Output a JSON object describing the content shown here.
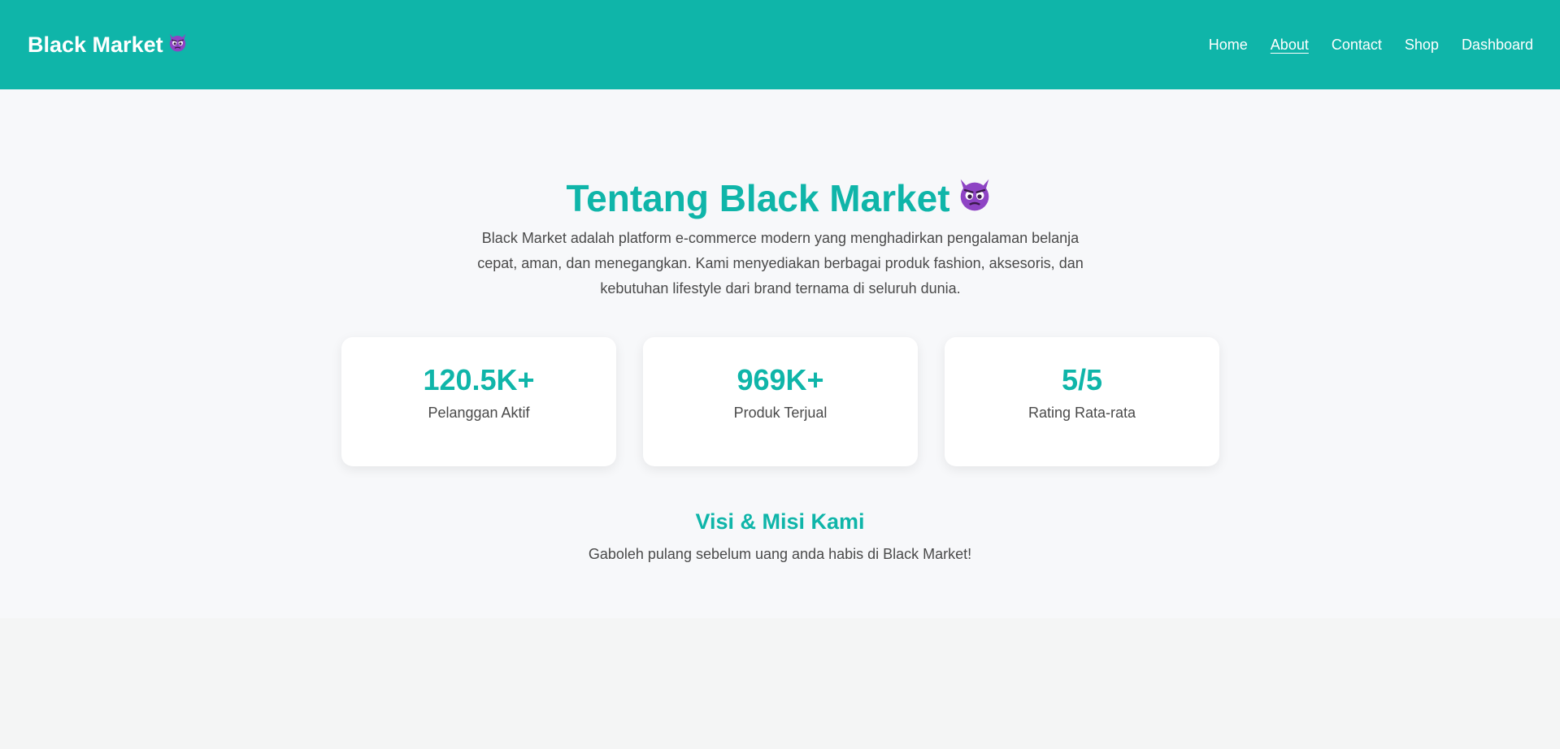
{
  "navbar": {
    "brand": "Black Market",
    "brand_icon": "devil-emoji",
    "links": [
      {
        "label": "Home",
        "active": false
      },
      {
        "label": "About",
        "active": true
      },
      {
        "label": "Contact",
        "active": false
      },
      {
        "label": "Shop",
        "active": false
      },
      {
        "label": "Dashboard",
        "active": false
      }
    ]
  },
  "about": {
    "title": "Tentang Black Market",
    "title_icon": "devil-emoji",
    "description": "Black Market adalah platform e-commerce modern yang menghadirkan pengalaman belanja cepat, aman, dan menegangkan. Kami menyediakan berbagai produk fashion, aksesoris, dan kebutuhan lifestyle dari brand ternama di seluruh dunia.",
    "stats": [
      {
        "value": "120.5K+",
        "label": "Pelanggan Aktif"
      },
      {
        "value": "969K+",
        "label": "Produk Terjual"
      },
      {
        "value": "5/5",
        "label": "Rating Rata-rata"
      }
    ],
    "vision_title": "Visi & Misi Kami",
    "vision_text": "Gaboleh pulang sebelum uang anda habis di Black Market!"
  },
  "colors": {
    "primary": "#0fb5a9",
    "text": "#4a4a4a",
    "section_bg": "#f7f8fa",
    "page_bg": "#f4f5f5",
    "card_bg": "#ffffff",
    "devil": "#8e44c4"
  }
}
